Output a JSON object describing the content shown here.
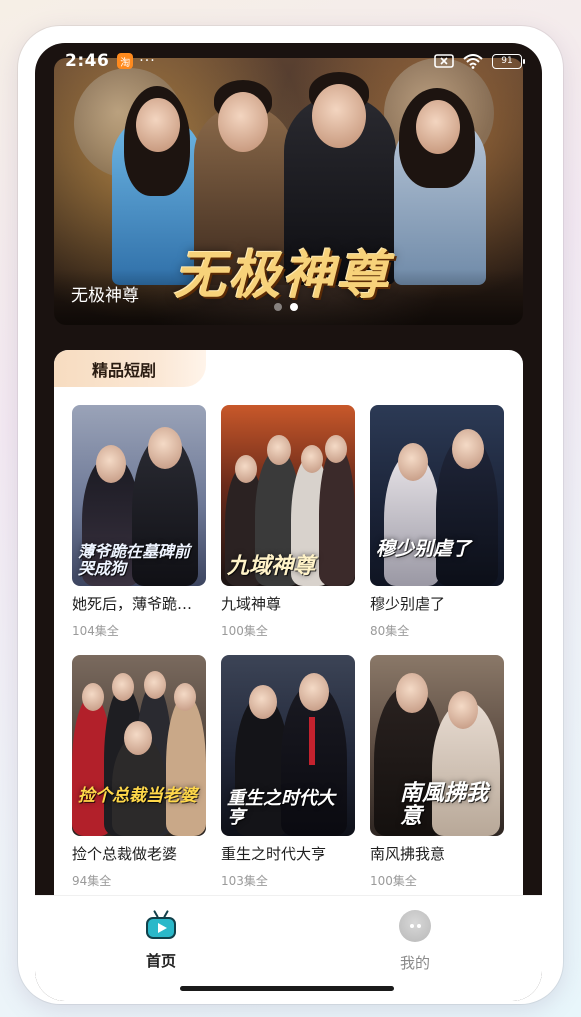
{
  "status_bar": {
    "time": "2:46",
    "battery": "91"
  },
  "banner": {
    "title": "无极神尊",
    "logo_text": "无极神尊",
    "slide_count": 2,
    "active_slide": 2
  },
  "section": {
    "title": "精品短剧"
  },
  "dramas": [
    {
      "title": "她死后，薄爷跪…",
      "episodes": "104集全",
      "poster_text": "薄爷跪在墓碑前哭成狗"
    },
    {
      "title": "九域神尊",
      "episodes": "100集全",
      "poster_text": "九域神尊"
    },
    {
      "title": "穆少别虐了",
      "episodes": "80集全",
      "poster_text": "穆少别虐了"
    },
    {
      "title": "捡个总裁做老婆",
      "episodes": "94集全",
      "poster_text": "捡个总裁当老婆"
    },
    {
      "title": "重生之时代大亨",
      "episodes": "103集全",
      "poster_text": "重生之时代大亨"
    },
    {
      "title": "南风拂我意",
      "episodes": "100集全",
      "poster_text": "南風拂我意"
    }
  ],
  "bottom_nav": {
    "home_label": "首页",
    "me_label": "我的",
    "home_icon": "tv-play-icon",
    "me_icon": "chat-bubble-icon",
    "active": "home",
    "accent_color": "#2ab8c9"
  }
}
